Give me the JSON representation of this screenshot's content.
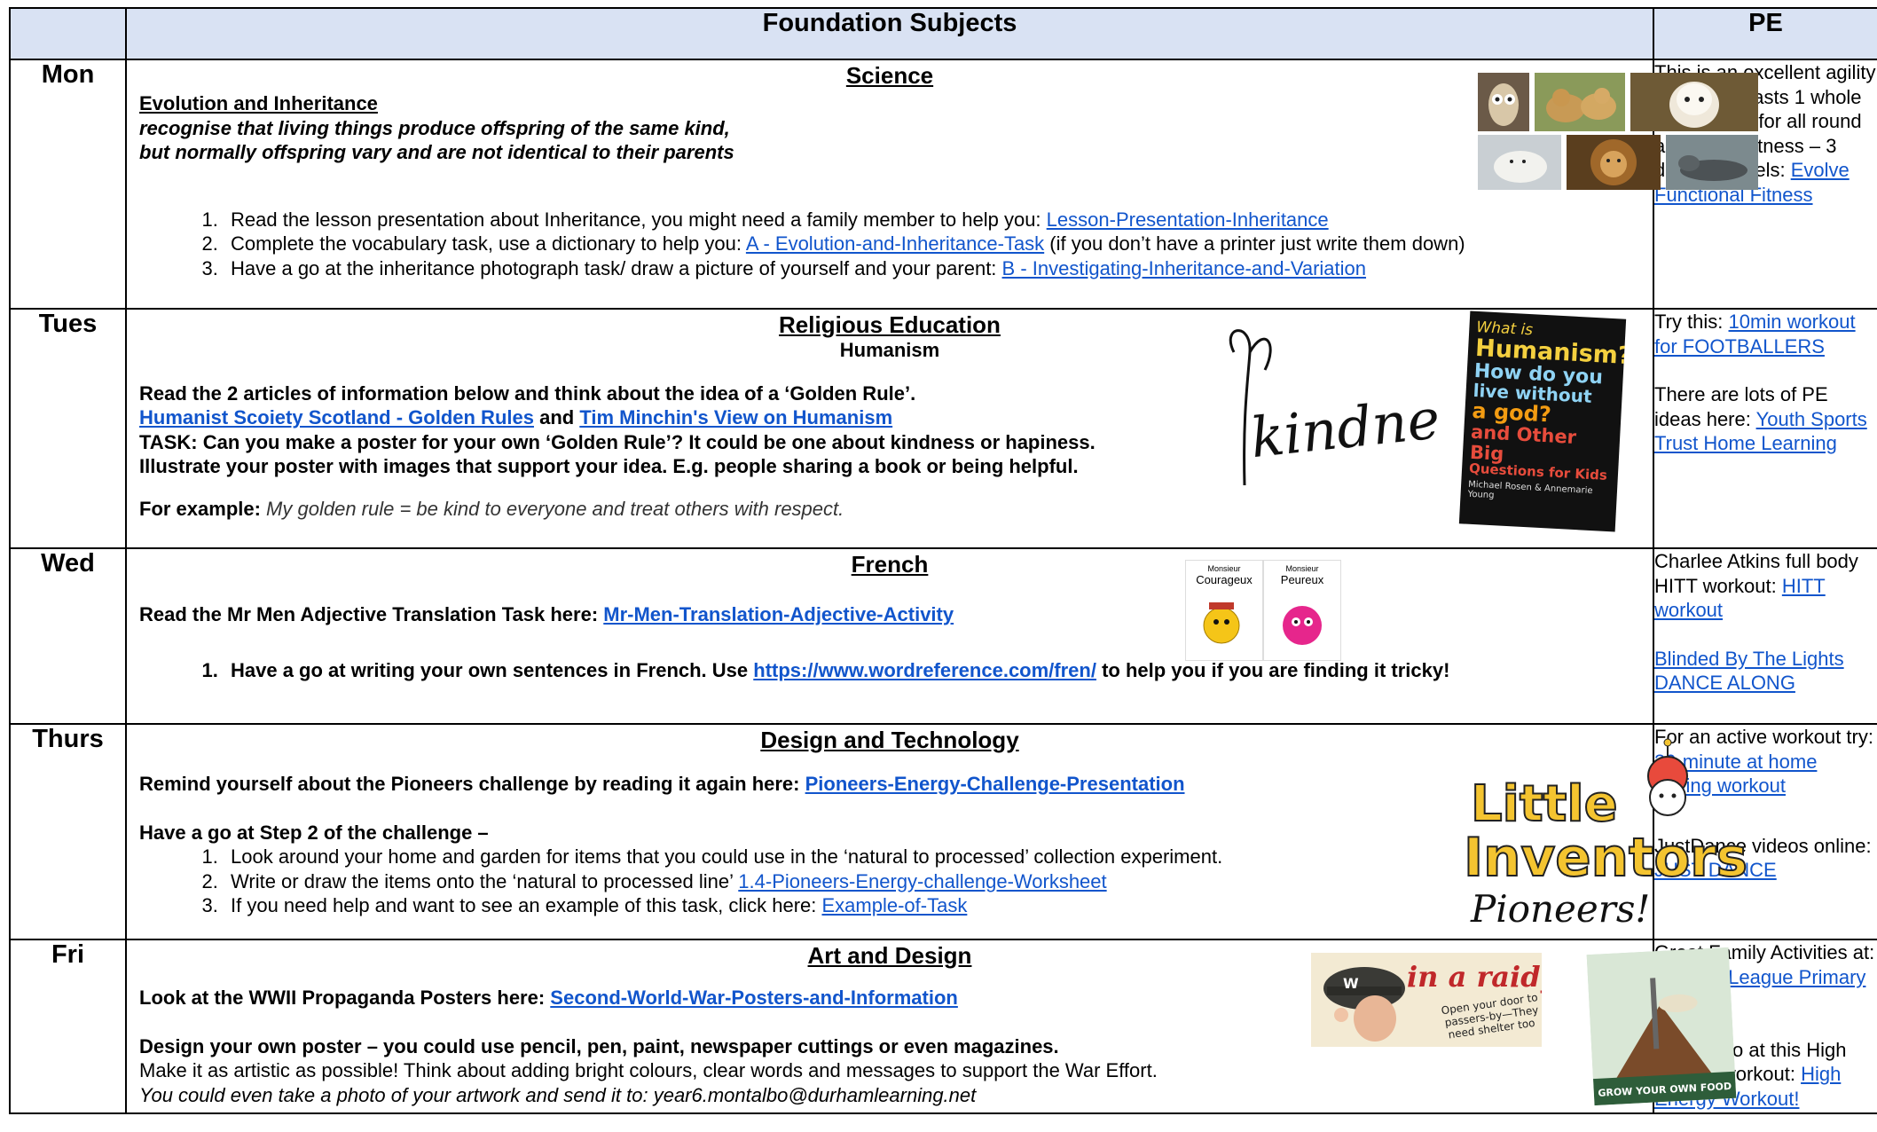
{
  "header": {
    "day_col": "",
    "foundation": "Foundation Subjects",
    "pe": "PE"
  },
  "days": {
    "mon": "Mon",
    "tue": "Tues",
    "wed": "Wed",
    "thu": "Thurs",
    "fri": "Fri"
  },
  "mon": {
    "subject": "Science",
    "topic": "Evolution and Inheritance",
    "objective_1": "recognise that living things produce offspring of the same kind,",
    "objective_2": "but normally offspring vary and are not identical to their parents",
    "task1_text": "Read the lesson presentation about Inheritance, you might need a family member to help you: ",
    "task1_link": "Lesson-Presentation-Inheritance",
    "task2_text": "Complete the vocabulary task, use a dictionary to help you: ",
    "task2_link": "A - Evolution-and-Inheritance-Task",
    "task2_after": " (if you don’t have a printer just write them down)",
    "task3_text": "Have a go at the inheritance photograph task/ draw a picture of yourself and your parent: ",
    "task3_link": "B - Investigating-Inheritance-and-Variation",
    "pe_text": "This is an excellent agility workout; it lasts 1 whole hour! Great for all round agility and fitness – 3 different levels: ",
    "pe_link": "Evolve Functional Fitness"
  },
  "tue": {
    "subject": "Religious Education",
    "subtitle": "Humanism",
    "line1": "Read the 2 articles of information below and think about the idea of a ‘Golden Rule’.",
    "link1": "Humanist Scoiety Scotland - Golden Rules",
    "and": " and ",
    "link2": "Tim Minchin's View on Humanism",
    "task1": "TASK: Can you make a poster for your own ‘Golden Rule’? It could be one about kindness or hapiness.",
    "task2": "Illustrate your poster with images that support your idea. E.g. people sharing a book or being helpful.",
    "example_label": "For example:",
    "example_text": " My golden rule = be kind to everyone and treat others with respect.",
    "kindness_word": "kindness",
    "book_line1": "What is",
    "book_line2": "Humanism?",
    "book_line3": "How do you",
    "book_line4": "live without",
    "book_line5": "a god?",
    "book_line6": "and Other Big",
    "book_line7": "Questions for Kids",
    "book_authors": "Michael Rosen & Annemarie Young",
    "pe_text1": "Try this: ",
    "pe_link1": "10min workout for FOOTBALLERS",
    "pe_text2": "There are lots of PE ideas here: ",
    "pe_link2": "Youth Sports Trust Home Learning"
  },
  "wed": {
    "subject": "French",
    "line1": "Read the Mr Men Adjective Translation Task here: ",
    "link1": "Mr-Men-Translation-Adjective-Activity",
    "task_text": "Have a go at writing your own sentences in French. Use ",
    "task_link": "https://www.wordreference.com/fren/",
    "task_after": " to help you if you are finding it tricky!",
    "card1_small": "Monsieur",
    "card1_name": "Courageux",
    "card2_small": "Monsieur",
    "card2_name": "Peureux",
    "pe_text1": "Charlee Atkins full body HITT workout: ",
    "pe_link1": "HITT workout",
    "pe_link2": "Blinded By The Lights DANCE ALONG"
  },
  "thu": {
    "subject": "Design and Technology",
    "line1": "Remind yourself about the Pioneers challenge by reading it again here: ",
    "link1": "Pioneers-Energy-Challenge-Presentation",
    "step": "Have a go at Step 2 of the challenge –",
    "task1": "Look around your home and garden for items that you could use in the ‘natural to processed’ collection experiment.",
    "task2_text": "Write or draw the items onto the ‘natural to processed line’ ",
    "task2_link": "1.4-Pioneers-Energy-challenge-Worksheet",
    "task3_text": "If you need help and want to see an example of this task, click here: ",
    "task3_link": "Example-of-Task",
    "logo_line1": "Little",
    "logo_line2": "Inventors",
    "logo_line3": "Pioneers!",
    "pe_text1": "For an active workout try: ",
    "pe_link1": "30-minute at home boxing workout",
    "pe_text2": "JustDance videos online: ",
    "pe_link2": "JUST DANCE"
  },
  "fri": {
    "subject": "Art and Design",
    "line1": "Look at the WWII Propaganda Posters here: ",
    "link1": "Second-World-War-Posters-and-Information",
    "design": "Design your own poster – you could use pencil, pen, paint, newspaper cuttings or even magazines.",
    "artistic": "Make it as artistic as possible! Think about adding bright colours, clear words and messages to support the War Effort.",
    "photo": "You could even take a photo of your artwork and send it to: year6.montalbo@durhamlearning.net",
    "poster1_title": "in a raid_",
    "poster1_sub1": "Open your door to",
    "poster1_sub2": "passers-by—They",
    "poster1_sub3": "need shelter too",
    "poster2_text": "GROW YOUR OWN FOOD",
    "pe_text1": "Great Family Activities at: ",
    "pe_link1": "Premier League Primary Stars",
    "pe_text2": "Have a go at this High Energy workout: ",
    "pe_link2": "High Energy Workout!"
  }
}
